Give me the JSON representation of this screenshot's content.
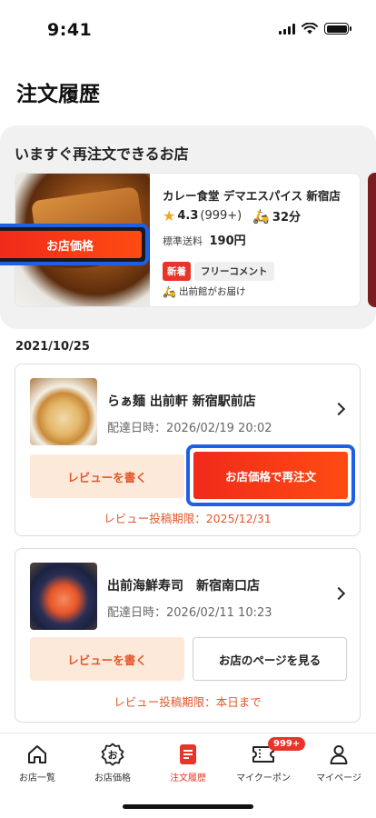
{
  "status_bar": {
    "time": "9:41"
  },
  "page": {
    "title": "注文履歴"
  },
  "reorder": {
    "heading": "いますぐ再注文できるお店",
    "store": {
      "name": "カレー食堂 デマエスパイス 新宿店",
      "rating": "4.3",
      "review_count": "(999+)",
      "delivery_time": "32分",
      "fee_label": "標準送料",
      "fee_value": "190円",
      "tag_new": "新着",
      "tag_free": "フリーコメント",
      "delivered_by": "出前館がお届け",
      "price_button": "お店価格"
    }
  },
  "orders": {
    "date": "2021/10/25",
    "items": [
      {
        "store": "らぁ麺 出前軒 新宿駅前店",
        "delivered_at": "配達日時：2026/02/19 20:02",
        "review_button": "レビューを書く",
        "action_button": "お店価格で再注文",
        "deadline": "レビュー投稿期限：2025/12/31"
      },
      {
        "store": "出前海鮮寿司　新宿南口店",
        "delivered_at": "配達日時：2026/02/11 10:23",
        "review_button": "レビューを書く",
        "action_button": "お店のページを見る",
        "deadline": "レビュー投稿期限：本日まで"
      }
    ]
  },
  "tabs": [
    {
      "label": "お店一覧",
      "icon": "home-icon"
    },
    {
      "label": "お店価格",
      "icon": "store-price-icon"
    },
    {
      "label": "注文履歴",
      "icon": "order-history-icon",
      "active": true
    },
    {
      "label": "マイクーポン",
      "icon": "coupon-icon",
      "badge": "999+"
    },
    {
      "label": "マイページ",
      "icon": "person-icon"
    }
  ],
  "colors": {
    "accent": "#e8342a",
    "highlight_border": "#1f5fe6",
    "review_bg": "#fde9d9",
    "review_text": "#e2582a"
  }
}
